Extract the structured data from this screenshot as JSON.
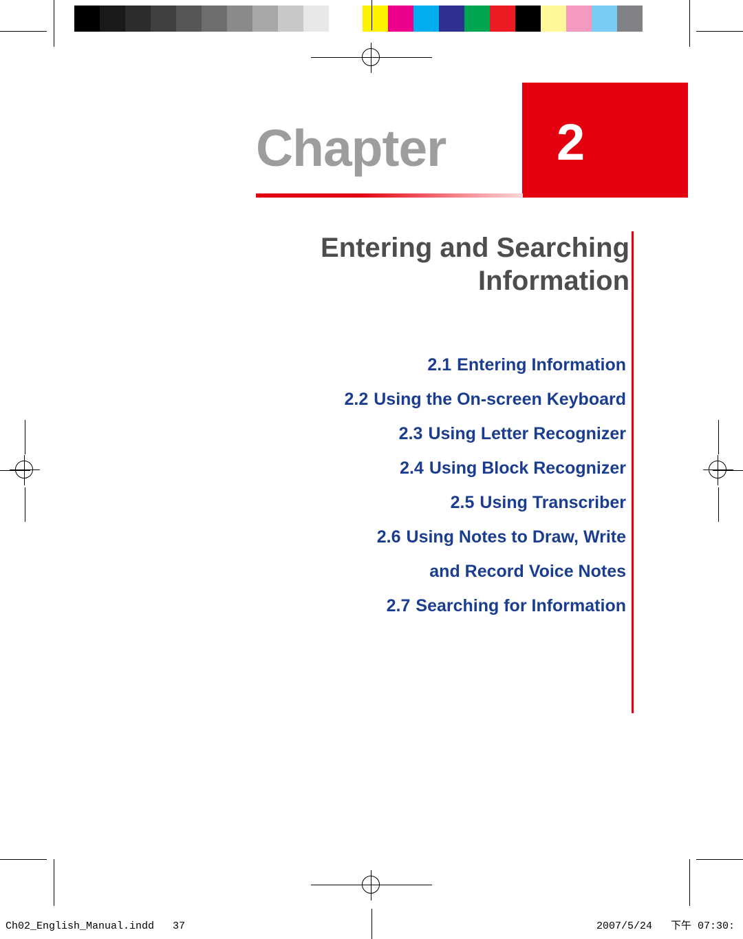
{
  "page": {
    "chapter_word": "Chapter",
    "chapter_number": "2",
    "title_line1": "Entering and Searching",
    "title_line2": "Information",
    "accent_color": "#e3000f",
    "title_color": "#4d4d4d",
    "toc_color": "#1b3d8f"
  },
  "toc": [
    {
      "num": "2.1",
      "label": "Entering Information"
    },
    {
      "num": "2.2",
      "label": "Using the On-screen Keyboard"
    },
    {
      "num": "2.3",
      "label": "Using Letter Recognizer"
    },
    {
      "num": "2.4",
      "label": "Using Block Recognizer"
    },
    {
      "num": "2.5",
      "label": "Using Transcriber"
    },
    {
      "num": "2.6",
      "label": "Using Notes to Draw, Write"
    },
    {
      "num": "",
      "label": "and Record Voice Notes"
    },
    {
      "num": "2.7",
      "label": "Searching for Information"
    }
  ],
  "footer": {
    "left": "Ch02_English_Manual.indd   37",
    "right": "2007/5/24   下午 07:30:"
  },
  "calibration": {
    "grays": [
      "#000000",
      "#1a1a1a",
      "#2d2d2d",
      "#404040",
      "#565656",
      "#6e6e6e",
      "#8a8a8a",
      "#a8a8a8",
      "#c8c8c8",
      "#e8e8e8",
      "#ffffff"
    ],
    "colors": [
      "#fff200",
      "#ec008c",
      "#00aeef",
      "#2e3192",
      "#00a651",
      "#ed1c24",
      "#000000",
      "#fff799",
      "#f49ac1",
      "#7accf4",
      "#808285"
    ]
  }
}
